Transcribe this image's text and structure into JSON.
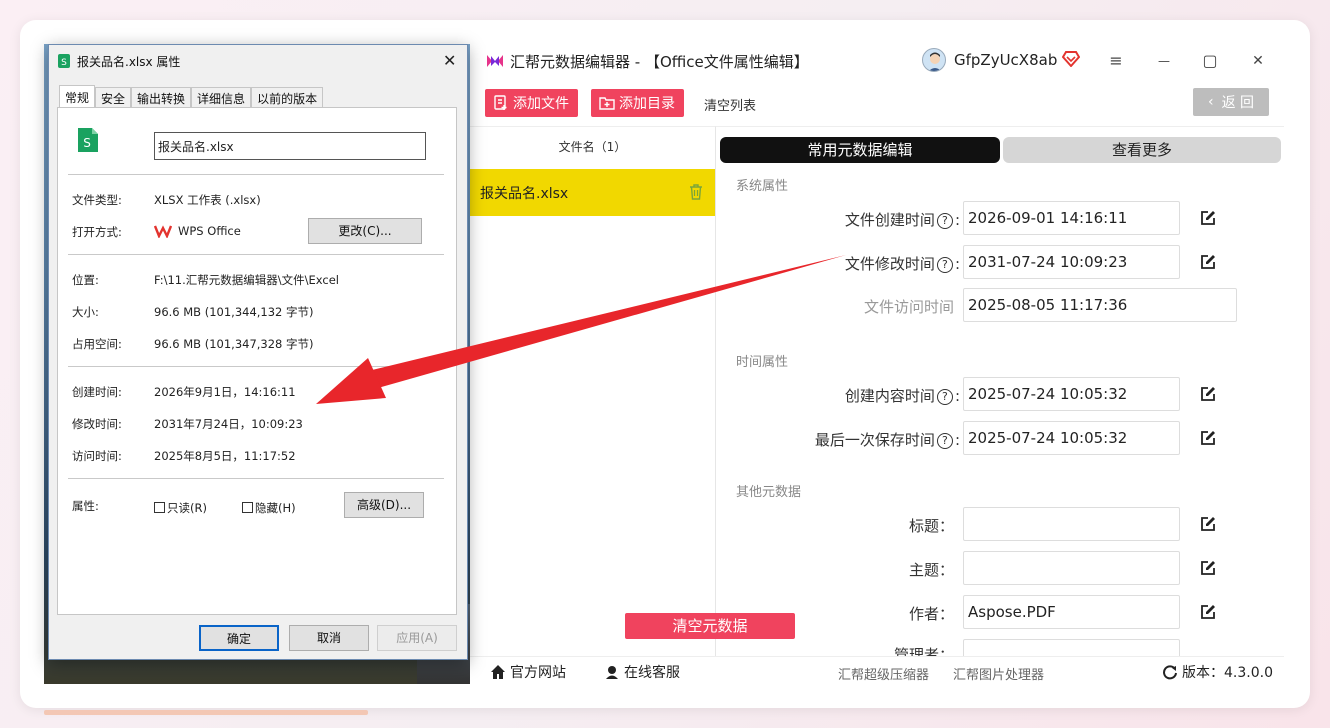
{
  "app": {
    "title": "汇帮元数据编辑器 - 【Office文件属性编辑】",
    "username": "GfpZyUcX8ab",
    "window_controls": {
      "menu": "≡",
      "minimize": "—",
      "maximize": "▢",
      "close": "✕"
    },
    "toolbar": {
      "add_file": "添加文件",
      "add_dir": "添加目录",
      "clear_list": "清空列表",
      "back": "返 回"
    },
    "file_list": {
      "header": "文件名（1）",
      "items": [
        {
          "name": "报关品名.xlsx"
        }
      ]
    },
    "tabs": {
      "common": "常用元数据编辑",
      "more": "查看更多"
    },
    "sections": {
      "system": "系统属性",
      "time": "时间属性",
      "other": "其他元数据"
    },
    "fields": {
      "created_label": "文件创建时间",
      "created_value": "2026-09-01 14:16:11",
      "modified_label": "文件修改时间",
      "modified_value": "2031-07-24 10:09:23",
      "accessed_label": "文件访问时间",
      "accessed_value": "2025-08-05 11:17:36",
      "content_created_label": "创建内容时间",
      "content_created_value": "2025-07-24 10:05:32",
      "last_saved_label": "最后一次保存时间",
      "last_saved_value": "2025-07-24 10:05:32",
      "title_label": "标题：",
      "title_value": "",
      "subject_label": "主题：",
      "subject_value": "",
      "author_label": "作者：",
      "author_value": "Aspose.PDF",
      "manager_label": "管理者：",
      "manager_value": ""
    },
    "clear_meta": "清空元数据",
    "footer": {
      "website": "官方网站",
      "support": "在线客服",
      "compressor": "汇帮超级压缩器",
      "image_tool": "汇帮图片处理器",
      "version": "版本：4.3.0.0"
    },
    "colors": {
      "accent": "#f0435e",
      "selected_row": "#f1d800",
      "active_tab": "#111111"
    }
  },
  "dialog": {
    "title": "报关品名.xlsx 属性",
    "close": "✕",
    "tabs": [
      "常规",
      "安全",
      "输出转换",
      "详细信息",
      "以前的版本"
    ],
    "filename": "报关品名.xlsx",
    "file_type_label": "文件类型:",
    "file_type_value": "XLSX 工作表 (.xlsx)",
    "open_with_label": "打开方式:",
    "open_with_value": "WPS Office",
    "change_button": "更改(C)...",
    "location_label": "位置:",
    "location_value": "F:\\11.汇帮元数据编辑器\\文件\\Excel",
    "size_label": "大小:",
    "size_value": "96.6 MB (101,344,132 字节)",
    "disk_label": "占用空间:",
    "disk_value": "96.6 MB (101,347,328 字节)",
    "created_label": "创建时间:",
    "created_value": "2026年9月1日，14:16:11",
    "modified_label": "修改时间:",
    "modified_value": "2031年7月24日，10:09:23",
    "accessed_label": "访问时间:",
    "accessed_value": "2025年8月5日，11:17:52",
    "attributes_label": "属性:",
    "readonly_label": "只读(R)",
    "hidden_label": "隐藏(H)",
    "advanced_button": "高级(D)...",
    "ok_button": "确定",
    "cancel_button": "取消",
    "apply_button": "应用(A)"
  }
}
